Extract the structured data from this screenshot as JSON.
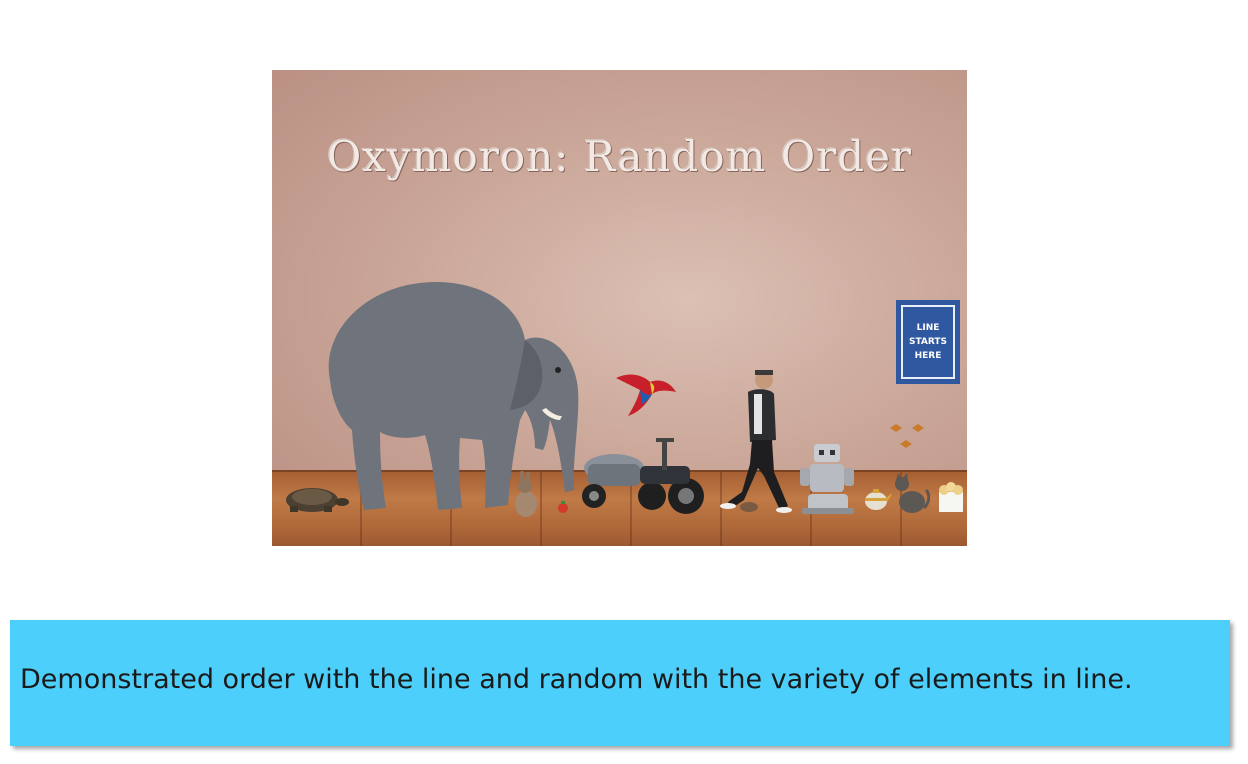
{
  "scene": {
    "title": "Oxymoron: Random Order",
    "sign_text": "LINE\nSTARTS\nHERE",
    "items": [
      "turtle-icon",
      "elephant-icon",
      "rabbit-icon",
      "strawberry-icon",
      "parrot-icon",
      "motorcycle-sidecar-icon",
      "walking-man-icon",
      "mouse-icon",
      "robot-icon",
      "butterflies-icon",
      "teapot-icon",
      "cat-icon",
      "popcorn-icon"
    ]
  },
  "caption": {
    "text": "Demonstrated order with the line and random with the variety of elements in line."
  },
  "colors": {
    "wall": "#cba89a",
    "floor": "#b06a3a",
    "sign": "#2f58a0",
    "caption_bar": "#4dcffc"
  }
}
